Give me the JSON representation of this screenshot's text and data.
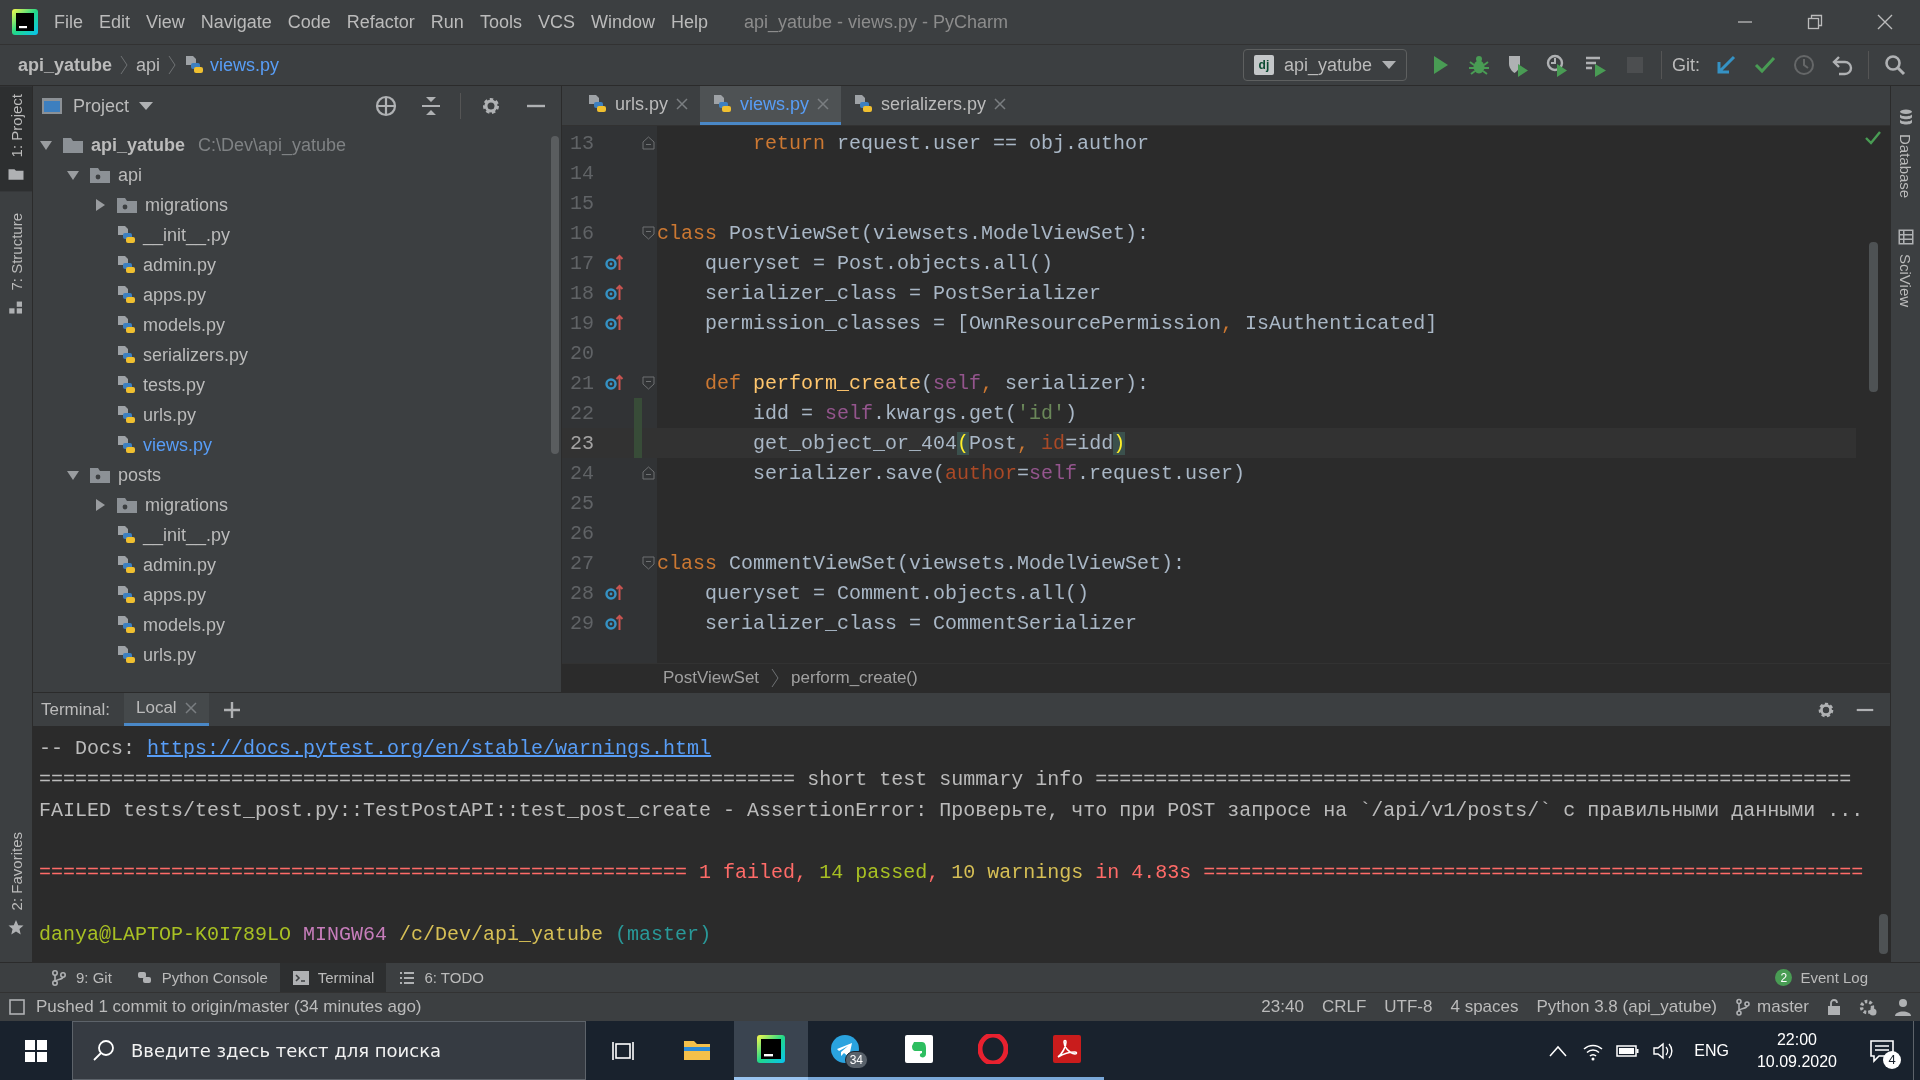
{
  "window": {
    "title": "api_yatube - views.py - PyCharm"
  },
  "menu": [
    "File",
    "Edit",
    "View",
    "Navigate",
    "Code",
    "Refactor",
    "Run",
    "Tools",
    "VCS",
    "Window",
    "Help"
  ],
  "navbar": {
    "breadcrumbs": [
      {
        "label": "api_yatube",
        "kind": "project"
      },
      {
        "label": "api",
        "kind": "folder"
      },
      {
        "label": "views.py",
        "kind": "file",
        "modified": true
      }
    ],
    "run_config": {
      "badge": "dj",
      "label": "api_yatube"
    },
    "toolbar": [
      {
        "kind": "run",
        "disabled": false
      },
      {
        "kind": "debug",
        "disabled": false
      },
      {
        "kind": "coverage",
        "disabled": false
      },
      {
        "kind": "profile",
        "disabled": false
      },
      {
        "kind": "concurrency",
        "disabled": false
      },
      {
        "kind": "stop",
        "disabled": true
      }
    ],
    "git_label": "Git:",
    "git_actions": [
      {
        "kind": "update",
        "disabled": false
      },
      {
        "kind": "commit",
        "disabled": false
      },
      {
        "kind": "history",
        "disabled": true
      },
      {
        "kind": "rollback",
        "disabled": false
      }
    ]
  },
  "side_tabs": {
    "left": [
      {
        "label": "1: Project",
        "kind": "project",
        "selected": true
      },
      {
        "label": "7: Structure",
        "kind": "structure",
        "selected": false
      }
    ],
    "left_bottom": [
      {
        "label": "2: Favorites",
        "kind": "favorites",
        "selected": false
      }
    ],
    "right": [
      {
        "label": "Database",
        "kind": "database",
        "selected": false
      },
      {
        "label": "SciView",
        "kind": "sciview",
        "selected": false
      }
    ]
  },
  "project": {
    "title": "Project",
    "tree": [
      {
        "name": "api_yatube",
        "path": "C:\\Dev\\api_yatube",
        "kind": "root",
        "expanded": true,
        "children": [
          {
            "name": "api",
            "kind": "folder",
            "expanded": true,
            "children": [
              {
                "name": "migrations",
                "kind": "folder",
                "expanded": false
              },
              {
                "name": "__init__.py",
                "kind": "file",
                "modified": false
              },
              {
                "name": "admin.py",
                "kind": "file",
                "modified": false
              },
              {
                "name": "apps.py",
                "kind": "file",
                "modified": false
              },
              {
                "name": "models.py",
                "kind": "file",
                "modified": false
              },
              {
                "name": "serializers.py",
                "kind": "file",
                "modified": false
              },
              {
                "name": "tests.py",
                "kind": "file",
                "modified": false
              },
              {
                "name": "urls.py",
                "kind": "file",
                "modified": false
              },
              {
                "name": "views.py",
                "kind": "file",
                "modified": true
              }
            ]
          },
          {
            "name": "posts",
            "kind": "folder",
            "expanded": true,
            "children": [
              {
                "name": "migrations",
                "kind": "folder",
                "expanded": false
              },
              {
                "name": "__init__.py",
                "kind": "file",
                "modified": false
              },
              {
                "name": "admin.py",
                "kind": "file",
                "modified": false
              },
              {
                "name": "apps.py",
                "kind": "file",
                "modified": false
              },
              {
                "name": "models.py",
                "kind": "file",
                "modified": false
              },
              {
                "name": "urls.py",
                "kind": "file",
                "modified": false
              }
            ]
          }
        ]
      }
    ]
  },
  "editor": {
    "tabs": [
      {
        "label": "urls.py",
        "selected": false,
        "modified": false
      },
      {
        "label": "views.py",
        "selected": true,
        "modified": true
      },
      {
        "label": "serializers.py",
        "selected": false,
        "modified": false
      }
    ],
    "lines": [
      {
        "number": "13",
        "override": false,
        "changed": false,
        "current": false,
        "fold_start": false,
        "fold_end": true,
        "tokens": [
          {
            "text": "        return",
            "kind": "kw"
          },
          {
            "text": " request.user == obj.author",
            "kind": "plain"
          }
        ]
      },
      {
        "number": "14",
        "override": false,
        "changed": false,
        "current": false,
        "fold_start": false,
        "fold_end": false
      },
      {
        "number": "15",
        "override": false,
        "changed": false,
        "current": false,
        "fold_start": false,
        "fold_end": false
      },
      {
        "number": "16",
        "override": false,
        "changed": false,
        "current": false,
        "fold_start": true,
        "fold_end": false,
        "tokens": [
          {
            "text": "class",
            "kind": "kw"
          },
          {
            "text": " PostViewSet(viewsets.ModelViewSet):",
            "kind": "plain"
          }
        ]
      },
      {
        "number": "17",
        "override": true,
        "changed": false,
        "current": false,
        "fold_start": false,
        "fold_end": false,
        "tokens": [
          {
            "text": "    queryset = Post.objects.all()",
            "kind": "plain"
          }
        ]
      },
      {
        "number": "18",
        "override": true,
        "changed": false,
        "current": false,
        "fold_start": false,
        "fold_end": false,
        "tokens": [
          {
            "text": "    serializer_class = PostSerializer",
            "kind": "plain"
          }
        ]
      },
      {
        "number": "19",
        "override": true,
        "changed": false,
        "current": false,
        "fold_start": false,
        "fold_end": false,
        "tokens": [
          {
            "text": "    permission_classes = [OwnResourcePermission",
            "kind": "plain"
          },
          {
            "text": ",",
            "kind": "kw"
          },
          {
            "text": " IsAuthenticated]",
            "kind": "plain"
          }
        ]
      },
      {
        "number": "20",
        "override": false,
        "changed": false,
        "current": false,
        "fold_start": false,
        "fold_end": false
      },
      {
        "number": "21",
        "override": true,
        "changed": false,
        "current": false,
        "fold_start": true,
        "fold_end": false,
        "tokens": [
          {
            "text": "    def ",
            "kind": "kw"
          },
          {
            "text": "perform_create",
            "kind": "fn"
          },
          {
            "text": "(",
            "kind": "plain"
          },
          {
            "text": "self",
            "kind": "self"
          },
          {
            "text": ",",
            "kind": "kw"
          },
          {
            "text": " serializer):",
            "kind": "plain"
          }
        ]
      },
      {
        "number": "22",
        "override": false,
        "changed": true,
        "current": false,
        "fold_start": false,
        "fold_end": false,
        "tokens": [
          {
            "text": "        idd = ",
            "kind": "plain"
          },
          {
            "text": "self",
            "kind": "self"
          },
          {
            "text": ".kwargs.get(",
            "kind": "plain"
          },
          {
            "text": "'id'",
            "kind": "str"
          },
          {
            "text": ")",
            "kind": "plain"
          }
        ]
      },
      {
        "number": "23",
        "override": false,
        "changed": true,
        "current": true,
        "fold_start": false,
        "fold_end": false,
        "tokens": [
          {
            "text": "        get_object_or_404",
            "kind": "plain"
          },
          {
            "text": "(",
            "kind": "match"
          },
          {
            "text": "Post",
            "kind": "plain"
          },
          {
            "text": ", ",
            "kind": "kw"
          },
          {
            "text": "id",
            "kind": "param"
          },
          {
            "text": "=idd",
            "kind": "plain"
          },
          {
            "text": ")",
            "kind": "match"
          }
        ]
      },
      {
        "number": "24",
        "override": false,
        "changed": false,
        "current": false,
        "fold_start": false,
        "fold_end": true,
        "tokens": [
          {
            "text": "        serializer.save(",
            "kind": "plain"
          },
          {
            "text": "author",
            "kind": "param"
          },
          {
            "text": "=",
            "kind": "plain"
          },
          {
            "text": "self",
            "kind": "self"
          },
          {
            "text": ".request.user)",
            "kind": "plain"
          }
        ]
      },
      {
        "number": "25",
        "override": false,
        "changed": false,
        "current": false,
        "fold_start": false,
        "fold_end": false
      },
      {
        "number": "26",
        "override": false,
        "changed": false,
        "current": false,
        "fold_start": false,
        "fold_end": false
      },
      {
        "number": "27",
        "override": false,
        "changed": false,
        "current": false,
        "fold_start": true,
        "fold_end": false,
        "tokens": [
          {
            "text": "class",
            "kind": "kw"
          },
          {
            "text": " CommentViewSet(viewsets.ModelViewSet):",
            "kind": "plain"
          }
        ]
      },
      {
        "number": "28",
        "override": true,
        "changed": false,
        "current": false,
        "fold_start": false,
        "fold_end": false,
        "tokens": [
          {
            "text": "    queryset = Comment.objects.all()",
            "kind": "plain"
          }
        ]
      },
      {
        "number": "29",
        "override": true,
        "changed": false,
        "current": false,
        "fold_start": false,
        "fold_end": false,
        "tokens": [
          {
            "text": "    serializer_class = CommentSerializer",
            "kind": "plain"
          }
        ]
      }
    ],
    "breadcrumbs": [
      "PostViewSet",
      "perform_create()"
    ]
  },
  "terminal": {
    "title": "Terminal:",
    "tabs": [
      {
        "label": "Local",
        "selected": true
      }
    ],
    "blocks": [
      {
        "lines": [
          [
            {
              "text": "-- Docs: ",
              "kind": "plain"
            },
            {
              "text": "https://docs.pytest.org/en/stable/warnings.html",
              "kind": "link"
            }
          ],
          [
            {
              "text": "=============================================================== short test summary info ===============================================================",
              "kind": "plain"
            }
          ],
          [
            {
              "text": "FAILED tests/test_post.py::TestPostAPI::test_post_create - AssertionError: Проверьте, что при POST запросе на `/api/v1/posts/` с правильными данными ...",
              "kind": "plain"
            }
          ]
        ]
      },
      {
        "lines": [
          [
            {
              "text": "====================================================== 1 failed, ",
              "kind": "fail"
            },
            {
              "text": "14 passed",
              "kind": "pass"
            },
            {
              "text": ", ",
              "kind": "fail"
            },
            {
              "text": "10 warnings",
              "kind": "warn"
            },
            {
              "text": " in 4.83s =======================================================",
              "kind": "fail"
            }
          ]
        ]
      },
      {
        "lines": [
          [
            {
              "text": "danya@LAPTOP-K0I789LO",
              "kind": "user"
            },
            {
              "text": " MINGW64",
              "kind": "host"
            },
            {
              "text": " /c/Dev/api_yatube",
              "kind": "path"
            },
            {
              "text": " (master)",
              "kind": "branch"
            }
          ]
        ]
      }
    ]
  },
  "tool_windows": [
    {
      "label": "9: Git",
      "kind": "git",
      "selected": false
    },
    {
      "label": "Python Console",
      "kind": "console",
      "selected": false
    },
    {
      "label": "Terminal",
      "kind": "terminal",
      "selected": true
    },
    {
      "label": "6: TODO",
      "kind": "todo",
      "selected": false
    }
  ],
  "event_log": {
    "label": "Event Log",
    "count": "2"
  },
  "status_bar": {
    "message": "Pushed 1 commit to origin/master (34 minutes ago)",
    "items": [
      {
        "label": "23:40",
        "kind": "text"
      },
      {
        "label": "CRLF",
        "kind": "text"
      },
      {
        "label": "UTF-8",
        "kind": "text"
      },
      {
        "label": "4 spaces",
        "kind": "text"
      },
      {
        "label": "Python 3.8 (api_yatube)",
        "kind": "text"
      },
      {
        "label": "master",
        "kind": "branch"
      }
    ]
  },
  "taskbar": {
    "search": {
      "placeholder": "Введите здесь текст для поиска"
    },
    "apps": [
      {
        "kind": "explorer",
        "running": false,
        "selected": false
      },
      {
        "kind": "pycharm",
        "running": true,
        "selected": true
      },
      {
        "kind": "telegram",
        "running": true,
        "selected": false,
        "badge": "34"
      },
      {
        "kind": "evernote",
        "running": true,
        "selected": false
      },
      {
        "kind": "opera",
        "running": true,
        "selected": false
      },
      {
        "kind": "acrobat",
        "running": true,
        "selected": false
      }
    ],
    "language": "ENG",
    "time": "22:00",
    "date": "10.09.2020",
    "notifications": "4"
  }
}
